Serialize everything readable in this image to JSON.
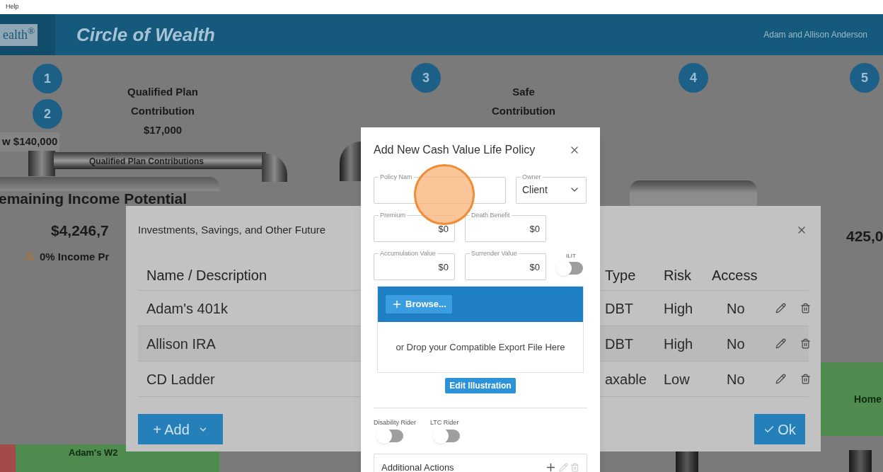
{
  "menu_bar": {
    "items": [
      "Help"
    ]
  },
  "header": {
    "logo": "ealth$^{®}$",
    "title": "Circle of Wealth",
    "client": "Adam and Allison Anderson"
  },
  "canvas": {
    "steps": [
      "1",
      "2",
      "3",
      "4",
      "5"
    ],
    "qualified_plan": {
      "lines": [
        "Qualified Plan",
        "Contribution",
        "$17,000"
      ]
    },
    "safe_contribution": {
      "lines": [
        "Safe",
        "Contribution"
      ]
    },
    "income_amount": "w $140,000",
    "pipe_label": "Qualified Plan Contributions",
    "remaining_title": "emaining Income Potential",
    "remaining_amount": "$4,246,7",
    "income_warning": "0% Income Pr",
    "right_amount": "425,0",
    "home_label": "Home",
    "w2_label": "Adam's W2"
  },
  "investments_dialog": {
    "title": "Investments, Savings, and Other Future",
    "columns": [
      "Name / Description",
      "Type",
      "Risk",
      "Access"
    ],
    "rows": [
      {
        "name": "Adam's 401k",
        "type": "DBT",
        "risk": "High",
        "access": "No"
      },
      {
        "name": "Allison IRA",
        "type": "DBT",
        "risk": "High",
        "access": "No"
      },
      {
        "name": "CD Ladder",
        "type": "axable",
        "risk": "Low",
        "access": "No"
      }
    ],
    "add_button": "+ Add",
    "ok_button": "Ok"
  },
  "policy_dialog": {
    "title": "Add New Cash Value Life Policy",
    "fields": [
      {
        "label": "Policy Nam"
      },
      {
        "label": "Owner",
        "value": "Client",
        "kind": "select"
      },
      {
        "label": "Premium",
        "value": "$0"
      },
      {
        "label": "Death Benefit",
        "value": "$0"
      },
      {
        "label": "Accumulation Value",
        "value": "$0"
      },
      {
        "label": "Surrender Value",
        "value": "$0"
      }
    ],
    "ilit": {
      "label": "ILIT",
      "on": false
    },
    "browse_button": "Browse...",
    "drop_text": "or Drop your Compatible Export File Here",
    "edit_button": "Edit Illustration",
    "riders": [
      {
        "label": "Disability Rider",
        "on": false
      },
      {
        "label": "LTC Rider",
        "on": false
      }
    ],
    "additional_actions": "Additional Actions"
  }
}
